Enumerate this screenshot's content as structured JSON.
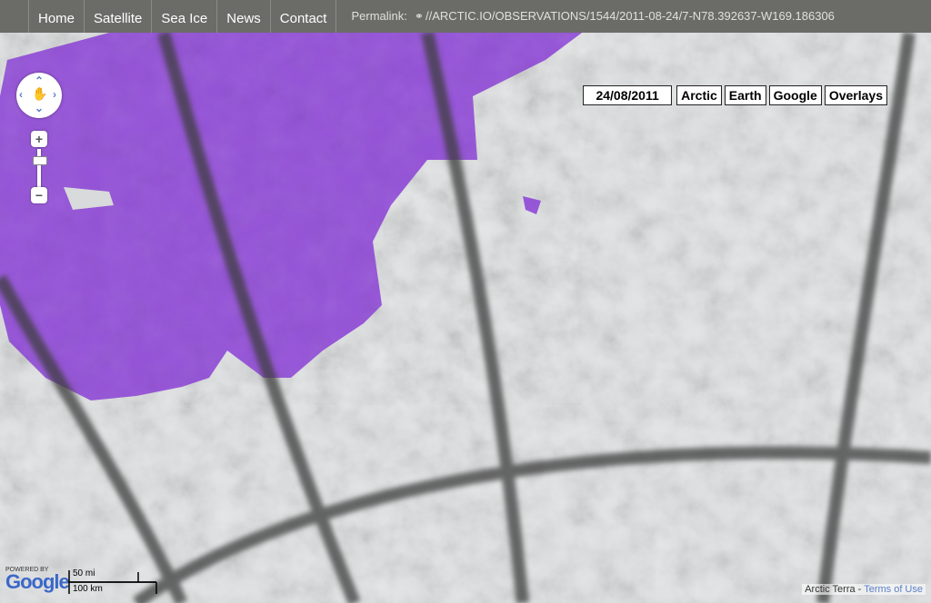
{
  "nav": {
    "items": [
      "Home",
      "Satellite",
      "Sea Ice",
      "News",
      "Contact"
    ],
    "permalink_label": "Permalink:",
    "permalink_url": "//ARCTIC.IO/OBSERVATIONS/1544/2011-08-24/7-N78.392637-W169.186306"
  },
  "map": {
    "date": "24/08/2011",
    "buttons": [
      "Arctic",
      "Earth",
      "Google",
      "Overlays"
    ],
    "attribution": "Arctic Terra",
    "terms": "Terms of Use",
    "powered_by": "POWERED BY",
    "google_logo": "Google",
    "scale_mi": "50 mi",
    "scale_km": "100 km"
  }
}
